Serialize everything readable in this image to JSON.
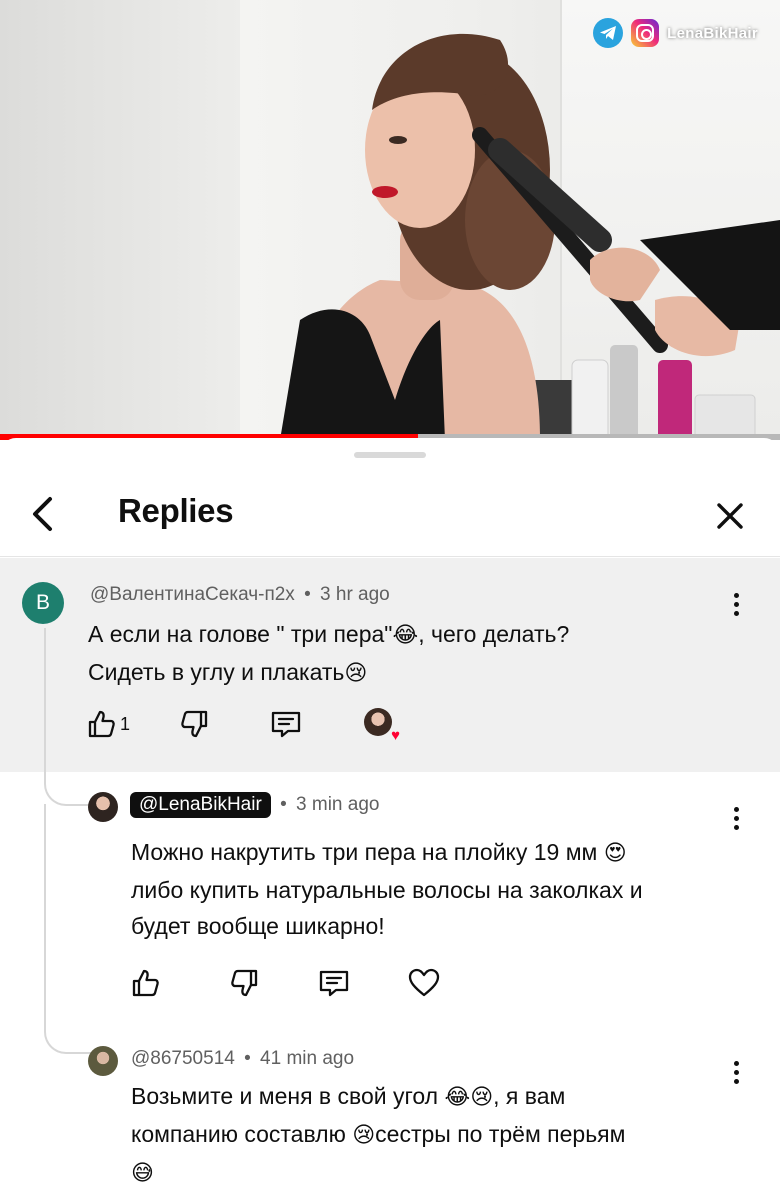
{
  "video": {
    "watermark_handle": "LenaBikHair",
    "played_percent": 53.6,
    "icons": [
      "telegram-icon",
      "instagram-icon"
    ]
  },
  "panel": {
    "title": "Replies",
    "back_icon": "chevron-left-icon",
    "close_icon": "close-icon"
  },
  "comments": [
    {
      "avatar_letter": "B",
      "avatar_color": "#1e7f6e",
      "author": "@ВалентинаСекач-п2х",
      "time": "3 hr ago",
      "line1": "А если на голове \" три пера\"",
      "emoji1": "😂",
      "line1b": ", чего делать?",
      "line2": "Сидеть в углу и плакать",
      "emoji2": "😢",
      "likes": "1",
      "creator_hearted": true
    },
    {
      "author": "@LenaBikHair",
      "time": "3 min ago",
      "line1": "Можно накрутить три пера на плойку 19 мм",
      "emoji1": "😍",
      "line2": "либо купить натуральные волосы на заколках и",
      "line3": "будет вообще шикарно!"
    },
    {
      "author": "@86750514",
      "time": "41 min ago",
      "line1": "Возьмите и меня в свой угол",
      "emoji1a": "😂",
      "emoji1b": "😢",
      "line1b": ", я вам",
      "line2a": "компанию составлю",
      "emoji2": "😢",
      "line2b": "сестры по трём перьям",
      "emoji3": "😅"
    }
  ],
  "separator": "•"
}
